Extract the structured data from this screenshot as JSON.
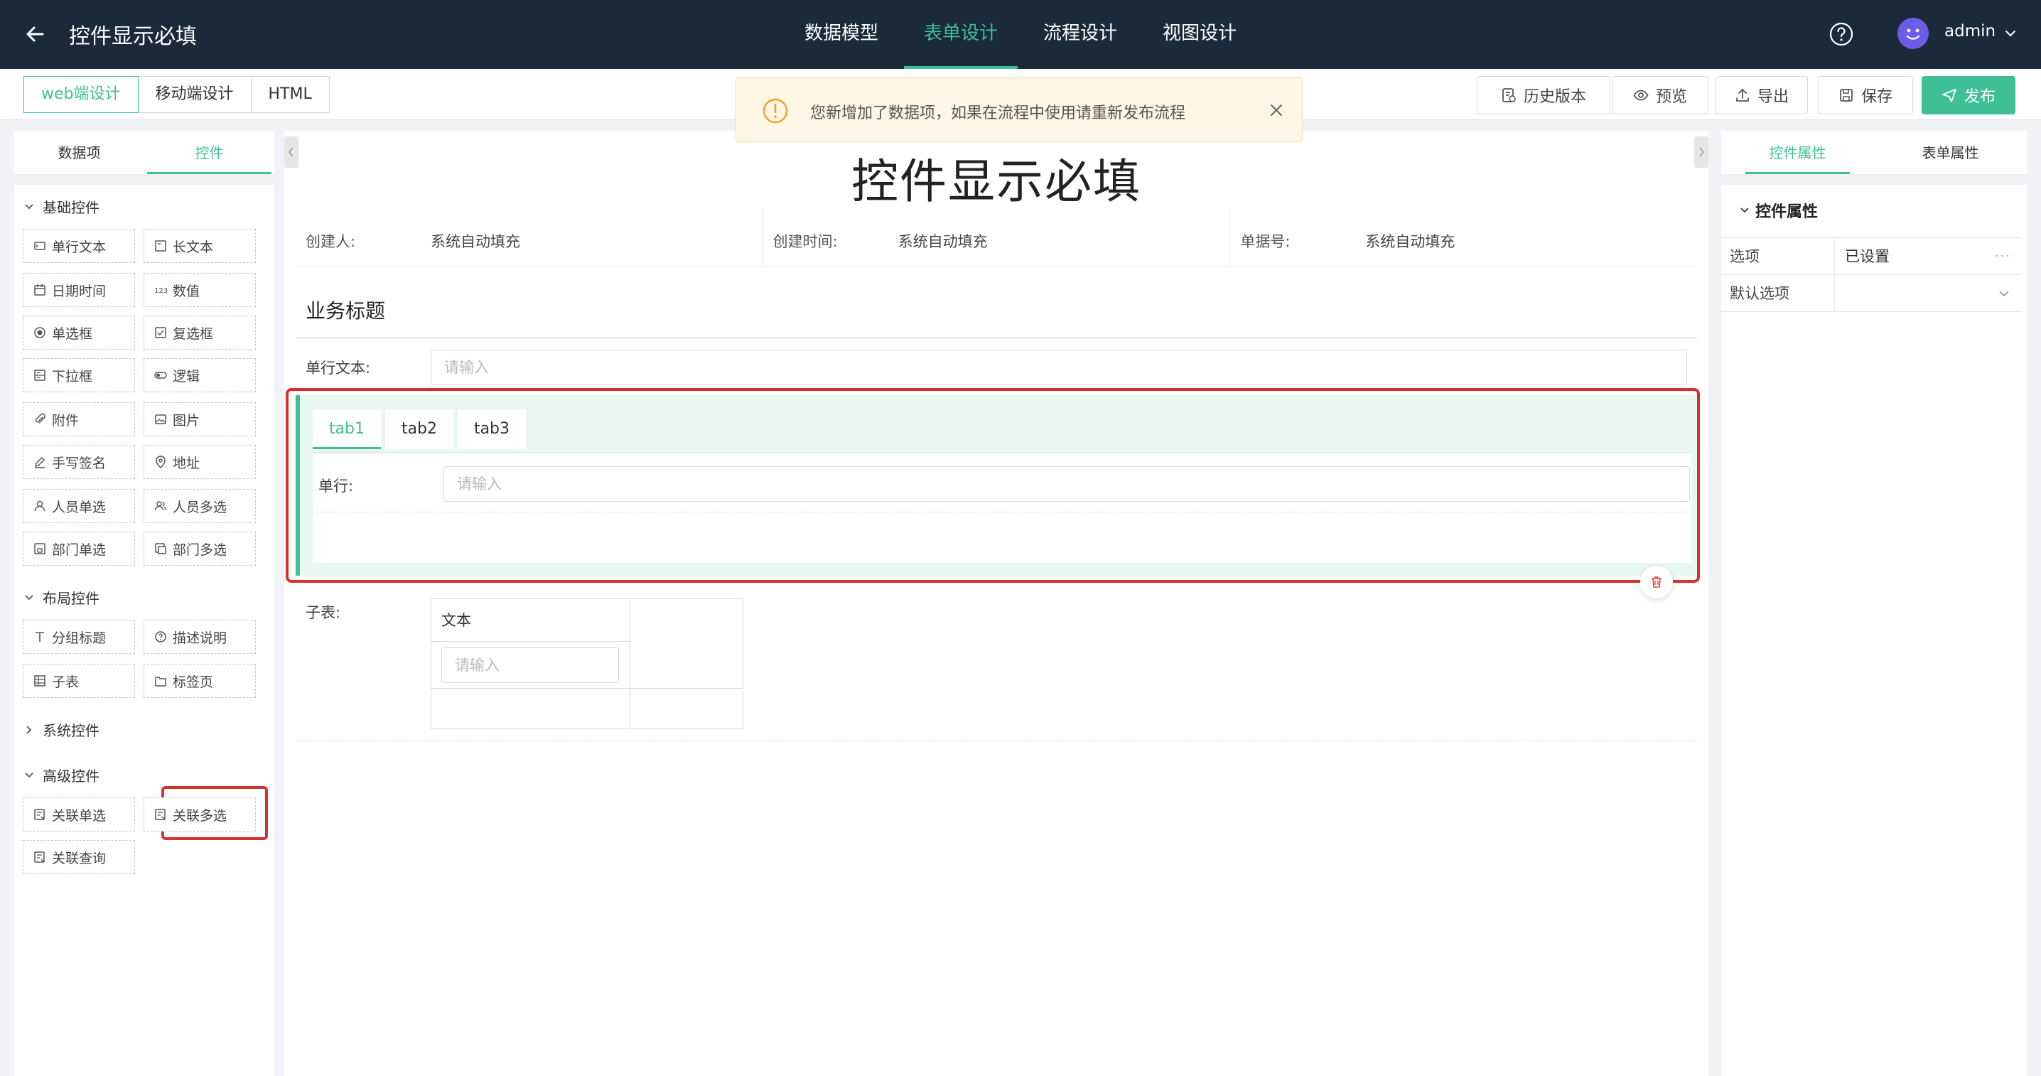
{
  "header": {
    "title": "控件显示必填",
    "nav": [
      "数据模型",
      "表单设计",
      "流程设计",
      "视图设计"
    ],
    "active_nav": "表单设计",
    "user": "admin"
  },
  "toolbar": {
    "modes": [
      "web端设计",
      "移动端设计",
      "HTML"
    ],
    "active_mode": "web端设计",
    "history_label": "历史版本",
    "preview_label": "预览",
    "export_label": "导出",
    "save_label": "保存",
    "publish_label": "发布"
  },
  "notice": {
    "text": "您新增加了数据项，如果在流程中使用请重新发布流程"
  },
  "left_panel": {
    "tabs": [
      "数据项",
      "控件"
    ],
    "active_tab": "控件",
    "groups": {
      "basic": {
        "title": "基础控件",
        "items": [
          "单行文本",
          "长文本",
          "日期时间",
          "数值",
          "单选框",
          "复选框",
          "下拉框",
          "逻辑",
          "附件",
          "图片",
          "手写签名",
          "地址",
          "人员单选",
          "人员多选",
          "部门单选",
          "部门多选"
        ]
      },
      "layout": {
        "title": "布局控件",
        "items": [
          "分组标题",
          "描述说明",
          "子表",
          "标签页"
        ]
      },
      "system": {
        "title": "系统控件"
      },
      "advanced": {
        "title": "高级控件",
        "items": [
          "关联单选",
          "关联多选",
          "关联查询"
        ]
      }
    }
  },
  "canvas": {
    "form_title": "控件显示必填",
    "info": [
      {
        "label": "创建人:",
        "value": "系统自动填充"
      },
      {
        "label": "创建时间:",
        "value": "系统自动填充"
      },
      {
        "label": "单据号:",
        "value": "系统自动填充"
      }
    ],
    "section_title": "业务标题",
    "single_text_label": "单行文本:",
    "input_placeholder": "请输入",
    "tabs": [
      "tab1",
      "tab2",
      "tab3"
    ],
    "active_tab": "tab1",
    "tab_field_label": "单行:",
    "subtable_label": "子表:",
    "subtable_column": "文本"
  },
  "right_panel": {
    "tabs": [
      "控件属性",
      "表单属性"
    ],
    "active_tab": "控件属性",
    "section_title": "控件属性",
    "rows": [
      {
        "key": "选项",
        "value": "已设置"
      },
      {
        "key": "默认选项",
        "value": ""
      }
    ]
  },
  "colors": {
    "accent": "#3fbf95",
    "topbar": "#1b2a3a",
    "highlight": "#d83030",
    "tab_bg": "#e8f8f1"
  }
}
